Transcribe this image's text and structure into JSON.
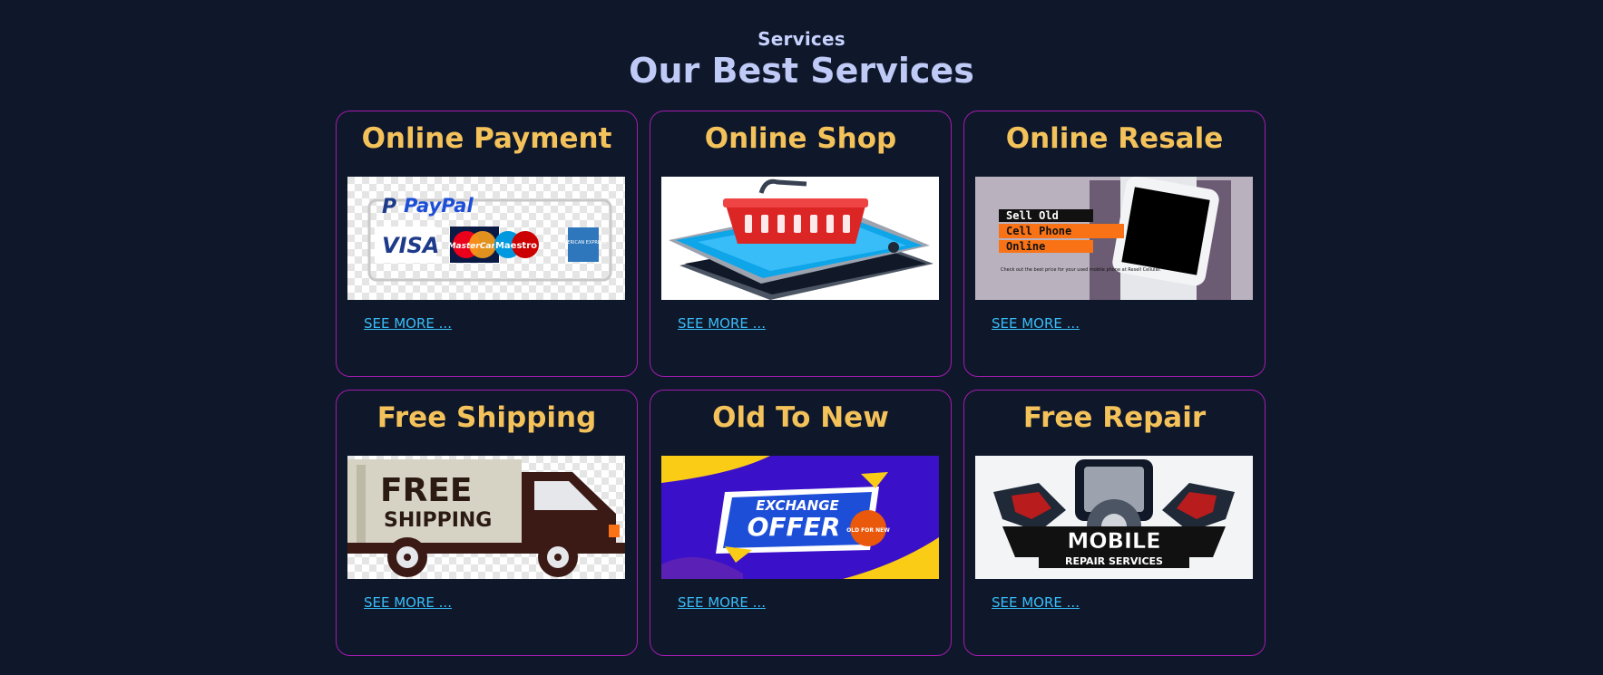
{
  "section": {
    "eyebrow": "Services",
    "title": "Our Best Services"
  },
  "cards": [
    {
      "title": "Online Payment",
      "link_label": "SEE MORE ...",
      "image": {
        "brand_paypal": "PayPal",
        "brand_visa": "VISA",
        "brand_mastercard": "MasterCard",
        "brand_maestro": "Maestro",
        "brand_amex": "AMERICAN EXPRESS"
      }
    },
    {
      "title": "Online Shop",
      "link_label": "SEE MORE ..."
    },
    {
      "title": "Online Resale",
      "link_label": "SEE MORE ...",
      "image": {
        "line1": "Sell Old",
        "line2": "Cell Phone",
        "line3": "Online",
        "caption": "Check out the best price for your used mobile phone at Resell Cellular."
      }
    },
    {
      "title": "Free Shipping",
      "link_label": "SEE MORE ...",
      "image": {
        "line1": "FREE",
        "line2": "SHIPPING"
      }
    },
    {
      "title": "Old To New",
      "link_label": "SEE MORE ...",
      "image": {
        "line1": "EXCHANGE",
        "line2": "OFFER",
        "badge": "OLD FOR NEW"
      }
    },
    {
      "title": "Free Repair",
      "link_label": "SEE MORE ...",
      "image": {
        "line1": "MOBILE",
        "line2": "REPAIR SERVICES"
      }
    }
  ],
  "colors": {
    "background": "#0f172a",
    "card_border": "#a21caf",
    "card_title": "#f4c25a",
    "link": "#38bdf8",
    "heading": "#bfcaf6"
  }
}
